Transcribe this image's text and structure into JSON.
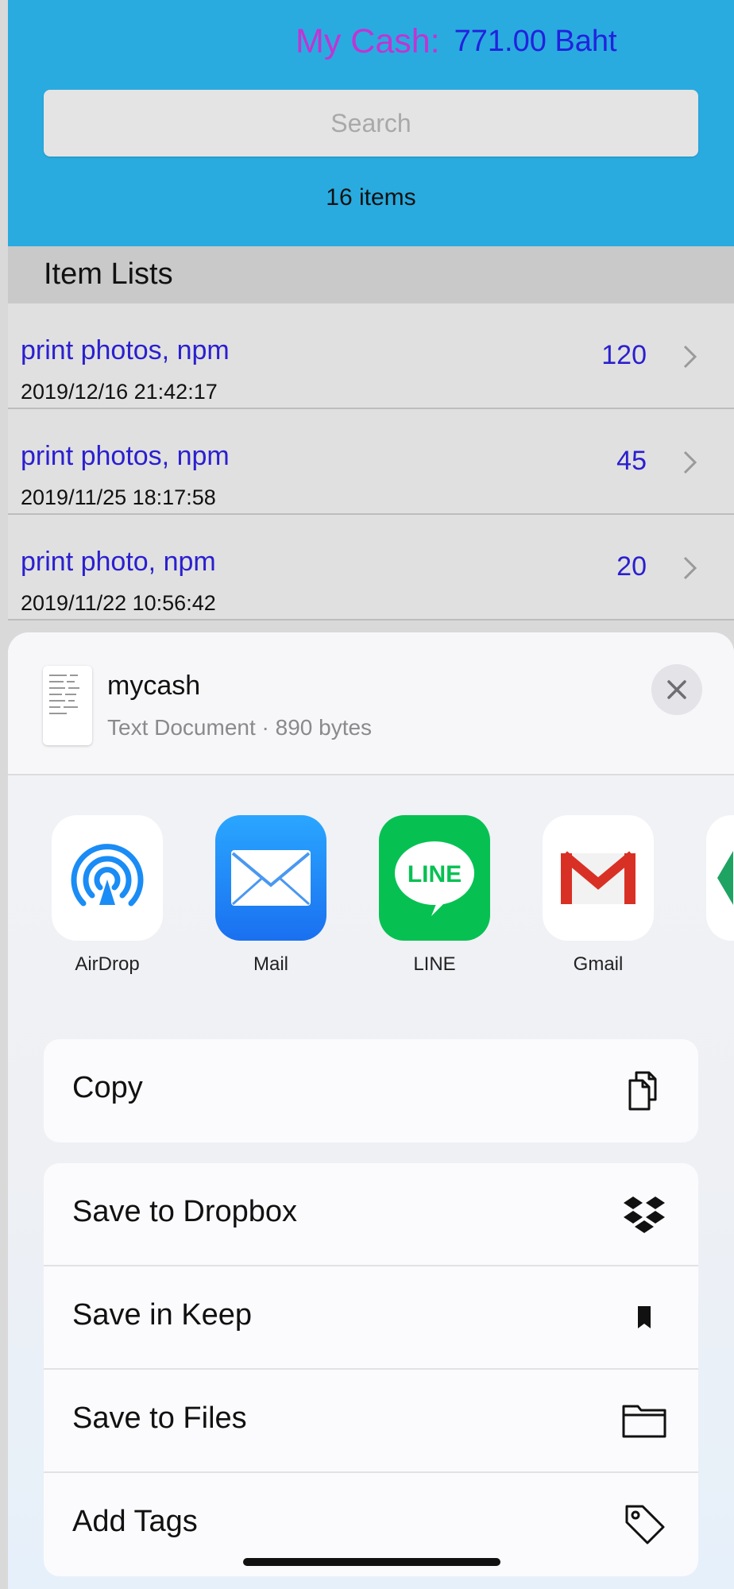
{
  "header": {
    "cash_label": "My Cash:",
    "cash_value": "771.00 Baht",
    "search_placeholder": "Search",
    "items_count": "16 items"
  },
  "list": {
    "section_title": "Item Lists",
    "rows": [
      {
        "title": "print photos, npm",
        "date": "2019/12/16 21:42:17",
        "amount": "120"
      },
      {
        "title": "print photos, npm",
        "date": "2019/11/25 18:17:58",
        "amount": "45"
      },
      {
        "title": "print photo, npm",
        "date": "2019/11/22 10:56:42",
        "amount": "20"
      }
    ]
  },
  "share_sheet": {
    "doc_name": "mycash",
    "doc_meta": "Text Document · 890 bytes",
    "apps": [
      {
        "label": "AirDrop",
        "icon": "airdrop-icon"
      },
      {
        "label": "Mail",
        "icon": "mail-icon"
      },
      {
        "label": "LINE",
        "icon": "line-icon",
        "icon_text": "LINE"
      },
      {
        "label": "Gmail",
        "icon": "gmail-icon"
      },
      {
        "label": "",
        "icon": "drive-icon"
      }
    ],
    "copy_action": {
      "label": "Copy",
      "icon": "copy-icon"
    },
    "actions": [
      {
        "label": "Save to Dropbox",
        "icon": "dropbox-icon"
      },
      {
        "label": "Save in Keep",
        "icon": "bookmark-icon"
      },
      {
        "label": "Save to Files",
        "icon": "folder-icon"
      },
      {
        "label": "Add Tags",
        "icon": "tag-icon"
      }
    ]
  },
  "colors": {
    "header_bg": "#29abe0",
    "cash_label": "#c134d3",
    "cash_value": "#2222dd",
    "list_text": "#2a1fcf",
    "mail_blue": "#1a8cf5",
    "line_green": "#06c152",
    "gmail_red": "#d93025"
  }
}
